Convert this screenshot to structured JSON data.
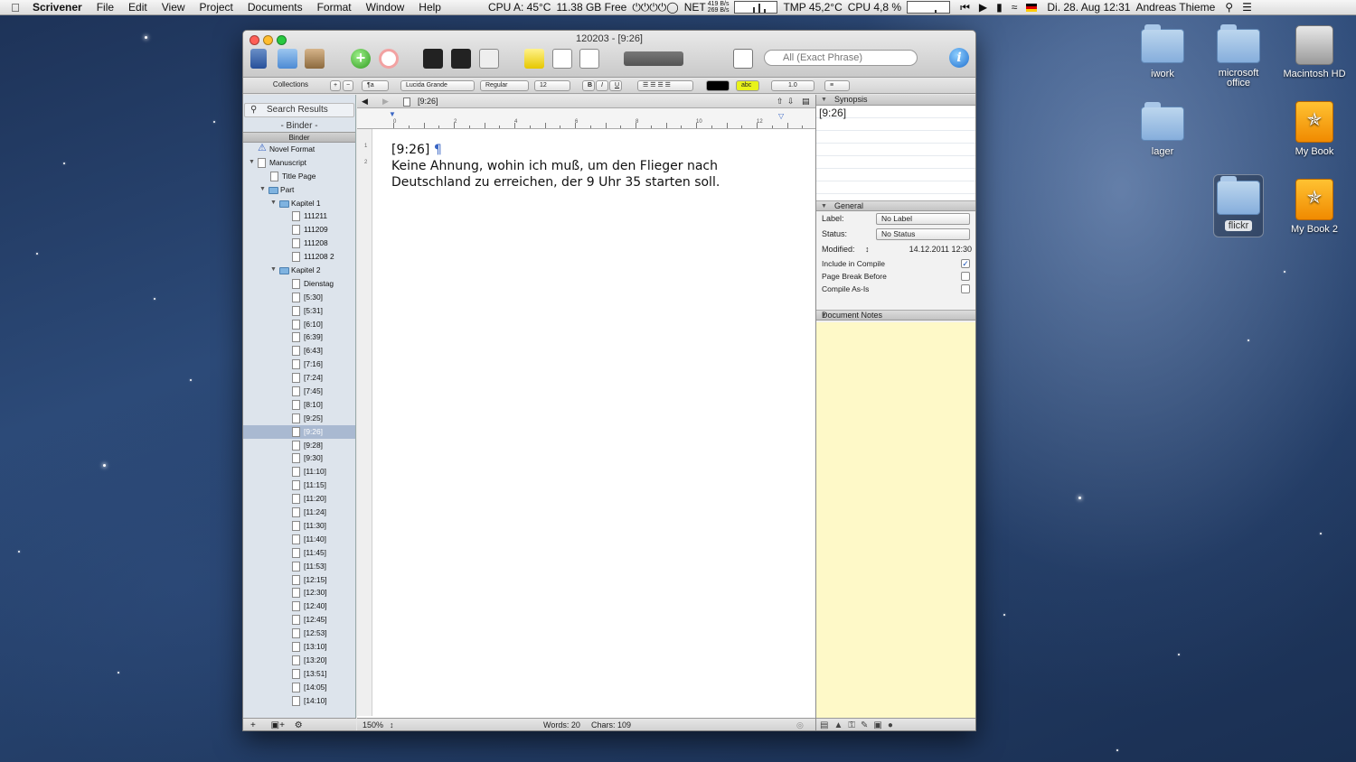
{
  "menubar": {
    "app_name": "Scrivener",
    "items": [
      "File",
      "Edit",
      "View",
      "Project",
      "Documents",
      "Format",
      "Window",
      "Help"
    ],
    "cpu_temp": "CPU A: 45°C",
    "disk_free": "11.38 GB Free",
    "net_label": "NET",
    "net_rates": [
      "419 B/s",
      "269 B/s"
    ],
    "tmp_label": "TMP 45,2°C",
    "cpu_usage": "CPU  4,8 %",
    "clock": "Di. 28. Aug  12:31",
    "user": "Andreas Thieme"
  },
  "window": {
    "title": "120203 - [9:26]",
    "search_placeholder": "All (Exact Phrase)",
    "format": {
      "font_family": "Lucida Grande",
      "font_style": "Regular",
      "font_size": "12",
      "bold": "B",
      "italic": "I",
      "underline": "U",
      "highlight_label": "abc",
      "line_spacing": "1.0"
    }
  },
  "binder": {
    "collections_label": "Collections",
    "search_results": "Search Results",
    "binder_title": "- Binder -",
    "header": "Binder",
    "items": [
      {
        "label": "Novel Format",
        "type": "format",
        "level": 0
      },
      {
        "label": "Manuscript",
        "type": "stack",
        "level": 0,
        "open": true
      },
      {
        "label": "Title Page",
        "type": "doc",
        "level": 1
      },
      {
        "label": "Part",
        "type": "folder",
        "level": 1,
        "open": true
      },
      {
        "label": "Kapitel 1",
        "type": "folder",
        "level": 2,
        "open": true
      },
      {
        "label": "111211",
        "type": "doc",
        "level": 3
      },
      {
        "label": "111209",
        "type": "doc",
        "level": 3
      },
      {
        "label": "111208",
        "type": "doc",
        "level": 3
      },
      {
        "label": "111208 2",
        "type": "doc",
        "level": 3
      },
      {
        "label": "Kapitel 2",
        "type": "folder",
        "level": 2,
        "open": true
      },
      {
        "label": "Dienstag",
        "type": "doc",
        "level": 3
      },
      {
        "label": "[5:30]",
        "type": "doc",
        "level": 3
      },
      {
        "label": "[5:31]",
        "type": "doc",
        "level": 3
      },
      {
        "label": "[6:10]",
        "type": "doc",
        "level": 3
      },
      {
        "label": "[6:39]",
        "type": "doc",
        "level": 3
      },
      {
        "label": "[6:43]",
        "type": "doc",
        "level": 3
      },
      {
        "label": "[7:16]",
        "type": "doc",
        "level": 3
      },
      {
        "label": "[7:24]",
        "type": "doc",
        "level": 3
      },
      {
        "label": "[7:45]",
        "type": "doc",
        "level": 3
      },
      {
        "label": "[8:10]",
        "type": "doc",
        "level": 3
      },
      {
        "label": "[9:25]",
        "type": "doc",
        "level": 3
      },
      {
        "label": "[9:26]",
        "type": "doc",
        "level": 3,
        "selected": true
      },
      {
        "label": "[9:28]",
        "type": "doc",
        "level": 3
      },
      {
        "label": "[9:30]",
        "type": "doc",
        "level": 3
      },
      {
        "label": "[11:10]",
        "type": "doc",
        "level": 3
      },
      {
        "label": "[11:15]",
        "type": "doc",
        "level": 3
      },
      {
        "label": "[11:20]",
        "type": "doc",
        "level": 3
      },
      {
        "label": "[11:24]",
        "type": "doc",
        "level": 3
      },
      {
        "label": "[11:30]",
        "type": "doc",
        "level": 3
      },
      {
        "label": "[11:40]",
        "type": "doc",
        "level": 3
      },
      {
        "label": "[11:45]",
        "type": "doc",
        "level": 3
      },
      {
        "label": "[11:53]",
        "type": "doc",
        "level": 3
      },
      {
        "label": "[12:15]",
        "type": "doc",
        "level": 3
      },
      {
        "label": "[12:30]",
        "type": "doc",
        "level": 3
      },
      {
        "label": "[12:40]",
        "type": "doc",
        "level": 3
      },
      {
        "label": "[12:45]",
        "type": "doc",
        "level": 3
      },
      {
        "label": "[12:53]",
        "type": "doc",
        "level": 3
      },
      {
        "label": "[13:10]",
        "type": "doc",
        "level": 3
      },
      {
        "label": "[13:20]",
        "type": "doc",
        "level": 3
      },
      {
        "label": "[13:51]",
        "type": "doc",
        "level": 3
      },
      {
        "label": "[14:05]",
        "type": "doc",
        "level": 3
      },
      {
        "label": "[14:10]",
        "type": "doc",
        "level": 3
      }
    ]
  },
  "editor": {
    "doc_title": "[9:26]",
    "ruler_ticks": [
      "0",
      "2",
      "4",
      "6",
      "8",
      "10",
      "12"
    ],
    "line_numbers": [
      "1",
      "2"
    ],
    "heading": "[9:26]",
    "body": "Keine Ahnung, wohin ich muß, um den Flieger nach Deutschland zu erreichen, der 9 Uhr 35 starten soll.",
    "zoom": "150%",
    "words": "Words: 20",
    "chars": "Chars: 109"
  },
  "inspector": {
    "synopsis_label": "Synopsis",
    "synopsis_text": "[9:26]",
    "general_label": "General",
    "label_label": "Label:",
    "label_value": "No Label",
    "status_label": "Status:",
    "status_value": "No Status",
    "modified_label": "Modified:",
    "modified_value": "14.12.2011 12:30",
    "include_compile": {
      "label": "Include in Compile",
      "checked": true
    },
    "page_break": {
      "label": "Page Break Before",
      "checked": false
    },
    "compile_as_is": {
      "label": "Compile As-Is",
      "checked": false
    },
    "notes_label": "Document Notes"
  },
  "desktop": {
    "icons": [
      {
        "label": "iwork",
        "kind": "folder"
      },
      {
        "label": "microsoft office",
        "kind": "folder"
      },
      {
        "label": "Macintosh HD",
        "kind": "disk"
      },
      {
        "label": "lager",
        "kind": "folder"
      },
      {
        "label": "My Book",
        "kind": "book"
      },
      {
        "label": "flickr",
        "kind": "folder"
      },
      {
        "label": "My Book 2",
        "kind": "book"
      }
    ]
  },
  "colors": {
    "selection": "#a9b9d1",
    "notes_bg": "#fef9c8",
    "pilcrow": "#3a66c4"
  }
}
